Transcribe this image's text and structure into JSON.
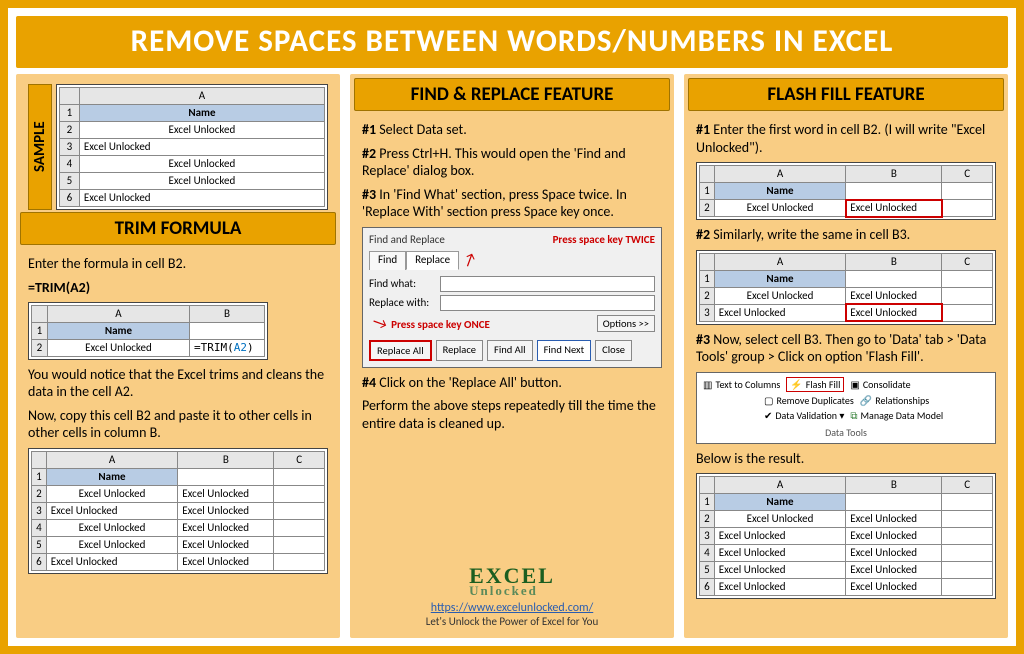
{
  "title": "REMOVE SPACES BETWEEN WORDS/NUMBERS IN EXCEL",
  "sample": {
    "label": "SAMPLE",
    "header": "Name",
    "rows": [
      "Excel Unlocked",
      "Excel        Unlocked",
      "Excel Unlocked",
      "Excel    Unlocked",
      "Excel           Unlocked"
    ]
  },
  "trim": {
    "title": "TRIM FORMULA",
    "instr1": "Enter the formula in cell B2.",
    "formula_prefix": "=TRIM(",
    "formula_ref": "A2",
    "formula_suffix": ")",
    "sheet_small": {
      "header": "Name",
      "a2": "Excel Unlocked",
      "b2_prefix": "=TRIM(",
      "b2_ref": "A2",
      "b2_suffix": ")"
    },
    "para1": "You would notice that the Excel trims and cleans the data in the cell A2.",
    "para2": "Now, copy this cell B2 and paste it to other cells in other cells in column B.",
    "result": {
      "header": "Name",
      "rows": [
        {
          "a": "Excel Unlocked",
          "b": "Excel Unlocked"
        },
        {
          "a": "Excel        Unlocked",
          "b": "Excel Unlocked"
        },
        {
          "a": "Excel Unlocked",
          "b": "Excel Unlocked"
        },
        {
          "a": "Excel    Unlocked",
          "b": "Excel Unlocked"
        },
        {
          "a": "Excel           Unlocked",
          "b": "Excel Unlocked"
        }
      ]
    }
  },
  "findreplace": {
    "title": "FIND & REPLACE FEATURE",
    "s1": "#1 Select Data set.",
    "s2": "#2 Press Ctrl+H. This would open the 'Find and Replace' dialog box.",
    "s3": "#3 In 'Find What' section, press Space twice. In 'Replace With' section press Space key once.",
    "dlg_title": "Find and Replace",
    "tab_find": "Find",
    "tab_replace": "Replace",
    "label_findwhat": "Find what:",
    "label_replacewith": "Replace with:",
    "hint1": "Press space key TWICE",
    "hint2": "Press space key ONCE",
    "btn_replaceall": "Replace All",
    "btn_replace": "Replace",
    "btn_findall": "Find All",
    "btn_findnext": "Find Next",
    "btn_close": "Close",
    "btn_options": "Options >>",
    "s4": "#4 Click on the 'Replace All' button.",
    "s5": "Perform the above steps repeatedly till the time the entire data is cleaned up.",
    "url": "https://www.excelunlocked.com/",
    "tagline": "Let's Unlock the Power of Excel for You",
    "logo1": "EXCEL",
    "logo2": "Unlocked"
  },
  "flash": {
    "title": "FLASH FILL FEATURE",
    "s1": "#1 Enter the first word in cell B2. (I will write \"Excel Unlocked\").",
    "sheet1": {
      "header": "Name",
      "a2": "Excel Unlocked",
      "b2": "Excel Unlocked"
    },
    "s2": "#2 Similarly, write the same in cell B3.",
    "sheet2": {
      "header": "Name",
      "a2": "Excel Unlocked",
      "b2": "Excel Unlocked",
      "a3": "Excel      Unlocked",
      "b3": "Excel Unlocked"
    },
    "s3": "#3 Now, select cell B3. Then go to 'Data' tab > 'Data Tools' group > Click on option 'Flash Fill'.",
    "ribbon": {
      "texttocolumns": "Text to Columns",
      "flashfill": "Flash Fill",
      "removedup": "Remove Duplicates",
      "dataval": "Data Validation ▾",
      "consolidate": "Consolidate",
      "relationships": "Relationships",
      "managedm": "Manage Data Model",
      "group": "Data Tools"
    },
    "s4": "Below is the result.",
    "result": {
      "header": "Name",
      "rows": [
        {
          "a": "Excel Unlocked",
          "b": "Excel Unlocked"
        },
        {
          "a": "Excel      Unlocked",
          "b": "Excel Unlocked"
        },
        {
          "a": "  Excel Unlocked",
          "b": "Excel Unlocked"
        },
        {
          "a": "   Excel  Unlocked",
          "b": "Excel Unlocked"
        },
        {
          "a": "Excel        Unlocked",
          "b": "Excel Unlocked"
        }
      ]
    }
  }
}
